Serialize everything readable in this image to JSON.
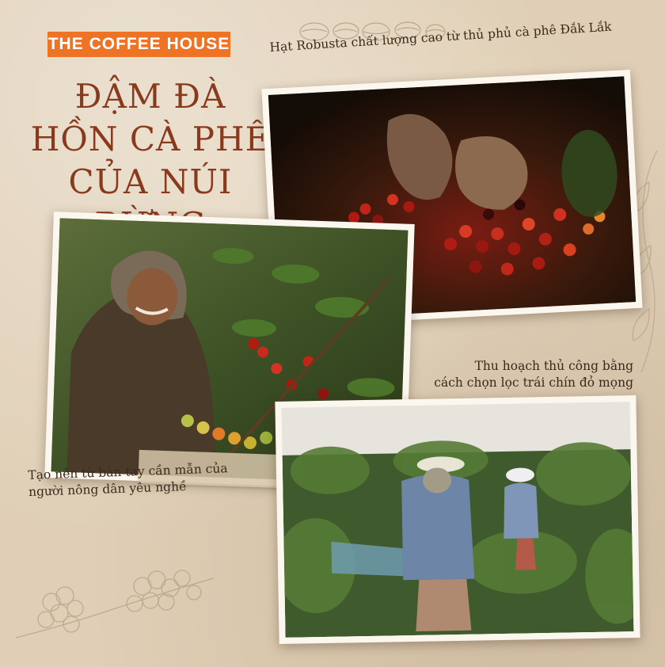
{
  "brand": {
    "label": "THE COFFEE HOUSE"
  },
  "headline": {
    "line1": "ĐẬM ĐÀ",
    "line2": "HỒN CÀ PHÊ",
    "line3": "CỦA NÚI RỪNG"
  },
  "captions": {
    "top_right": "Hạt Robusta chất lượng cao từ thủ phủ cà phê Đắk Lắk",
    "middle_right_line1": "Thu hoạch thủ công bằng",
    "middle_right_line2": "cách chọn lọc trái chín đỏ mọng",
    "bottom_left_line1": "Tạo nên từ bàn tay cần mẫn của",
    "bottom_left_line2": "người nông dân yêu nghề"
  },
  "colors": {
    "brand_orange": "#ee7325",
    "headline_brown": "#8a3a1c",
    "paper": "#e0cfb6",
    "caption_text": "#3b2a1a"
  },
  "icons": [
    "coffee-beans-sketch",
    "coffee-cherry-branch-sketch",
    "leaf-sketch"
  ]
}
